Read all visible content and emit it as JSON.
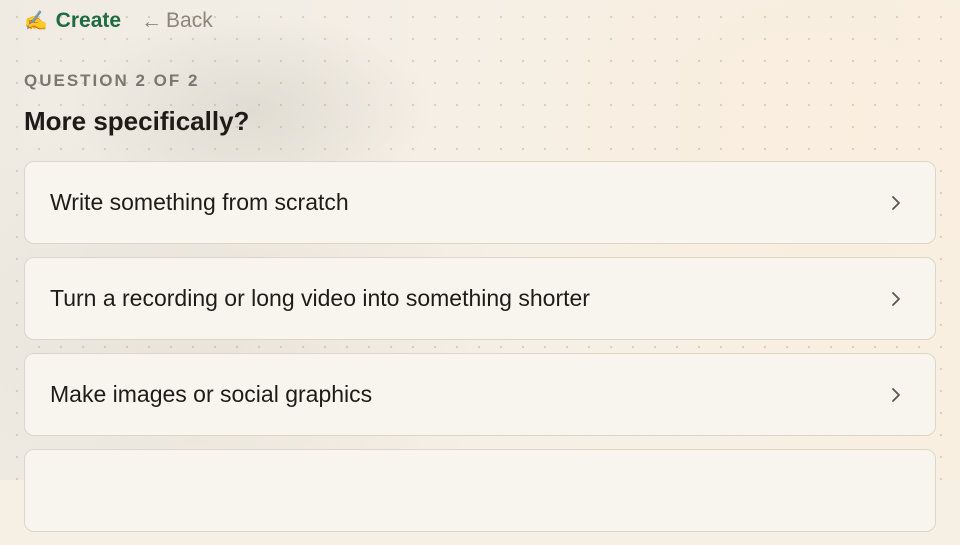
{
  "header": {
    "create_icon": "✍️",
    "create_label": "Create",
    "back_arrow": "←",
    "back_label": "Back"
  },
  "question": {
    "progress": "QUESTION 2 OF 2",
    "title": "More specifically?"
  },
  "options": [
    {
      "label": "Write something from scratch",
      "icon": "chevron-right-icon"
    },
    {
      "label": "Turn a recording or long video into something shorter",
      "icon": "chevron-right-icon"
    },
    {
      "label": "Make images or social graphics",
      "icon": "chevron-right-icon"
    },
    {
      "label": "",
      "icon": "chevron-right-icon"
    }
  ],
  "colors": {
    "accent": "#1f6b3f",
    "muted": "#8b857c",
    "card_bg": "#f8f5ef",
    "card_border": "#dcd5ca"
  }
}
